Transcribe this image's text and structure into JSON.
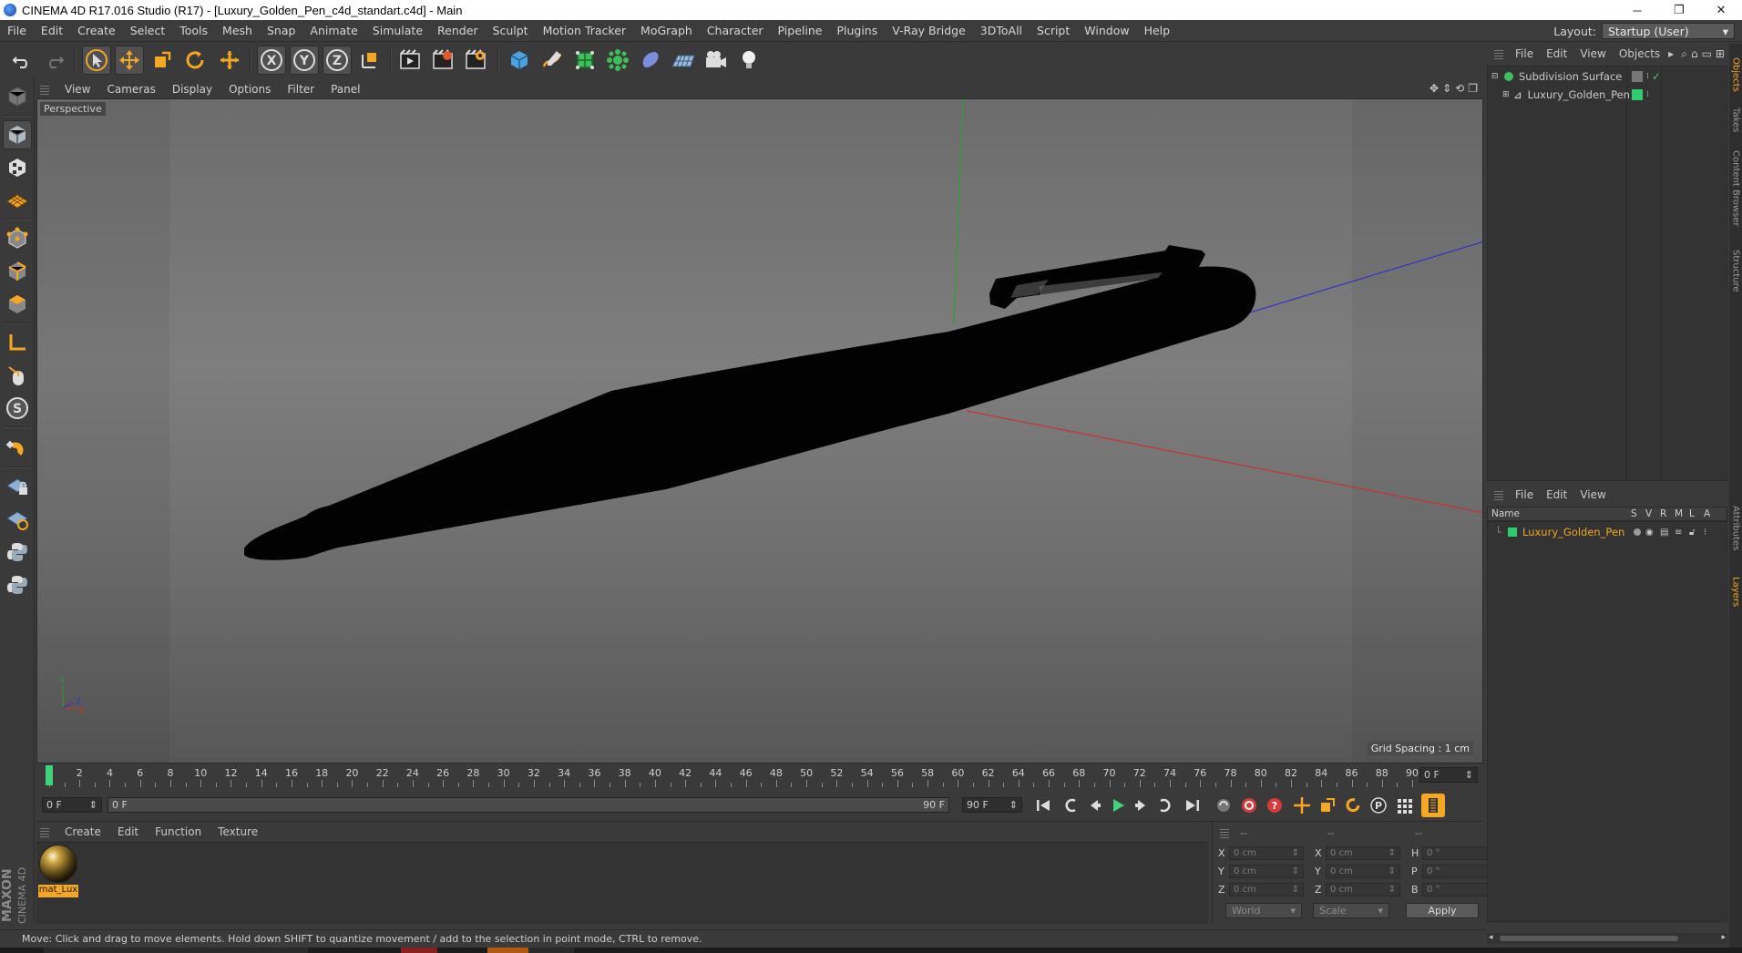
{
  "window": {
    "title": "CINEMA 4D R17.016 Studio (R17) - [Luxury_Golden_Pen_c4d_standart.c4d] - Main",
    "controls": [
      "─",
      "❐",
      "✕"
    ]
  },
  "menubar": {
    "items": [
      "File",
      "Edit",
      "Create",
      "Select",
      "Tools",
      "Mesh",
      "Snap",
      "Animate",
      "Simulate",
      "Render",
      "Sculpt",
      "Motion Tracker",
      "MoGraph",
      "Character",
      "Pipeline",
      "Plugins",
      "V-Ray Bridge",
      "3DToAll",
      "Script",
      "Window",
      "Help"
    ],
    "layout_label": "Layout:",
    "layout_value": "Startup (User)"
  },
  "viewport": {
    "menu": [
      "View",
      "Cameras",
      "Display",
      "Options",
      "Filter",
      "Panel"
    ],
    "camera_label": "Perspective",
    "grid_spacing": "Grid Spacing : 1 cm",
    "axis_labels": {
      "y": "Y",
      "z": "Z",
      "x": "X"
    }
  },
  "timeline": {
    "ticks": [
      "0",
      "2",
      "4",
      "6",
      "8",
      "10",
      "12",
      "14",
      "16",
      "18",
      "20",
      "22",
      "24",
      "26",
      "28",
      "30",
      "32",
      "34",
      "36",
      "38",
      "40",
      "42",
      "44",
      "46",
      "48",
      "50",
      "52",
      "54",
      "56",
      "58",
      "60",
      "62",
      "64",
      "66",
      "68",
      "70",
      "72",
      "74",
      "76",
      "78",
      "80",
      "82",
      "84",
      "86",
      "88",
      "90"
    ],
    "current_frame": "0 F",
    "start_field": "0 F",
    "range_start": "0 F",
    "range_end": "90 F",
    "end_field": "90 F"
  },
  "materials": {
    "menu": [
      "Create",
      "Edit",
      "Function",
      "Texture"
    ],
    "items": [
      {
        "name": "mat_Lux"
      }
    ]
  },
  "coordinates": {
    "headers": [
      "--",
      "--",
      "--"
    ],
    "rows": [
      {
        "a": "X",
        "av": "0 cm",
        "b": "X",
        "bv": "0 cm",
        "c": "H",
        "cv": "0 °"
      },
      {
        "a": "Y",
        "av": "0 cm",
        "b": "Y",
        "bv": "0 cm",
        "c": "P",
        "cv": "0 °"
      },
      {
        "a": "Z",
        "av": "0 cm",
        "b": "Z",
        "bv": "0 cm",
        "c": "B",
        "cv": "0 °"
      }
    ],
    "space": "World",
    "mode": "Scale",
    "apply": "Apply"
  },
  "objects": {
    "menu": [
      "File",
      "Edit",
      "View",
      "Objects"
    ],
    "items": [
      {
        "name": "Subdivision Surface",
        "level": 0
      },
      {
        "name": "Luxury_Golden_Pen",
        "level": 1
      }
    ]
  },
  "layers": {
    "menu": [
      "File",
      "Edit",
      "View"
    ],
    "columns": [
      "Name",
      "S",
      "V",
      "R",
      "M",
      "L",
      "A"
    ],
    "items": [
      {
        "name": "Luxury_Golden_Pen",
        "color": "#2ecc71"
      }
    ]
  },
  "side_tabs": [
    "Objects",
    "Takes",
    "Content Browser",
    "Structure",
    "Attributes",
    "Layers"
  ],
  "status": "Move: Click and drag to move elements. Hold down SHIFT to quantize movement / add to the selection in point mode, CTRL to remove.",
  "colors": {
    "accent": "#f5a623",
    "playhead": "#3fd27a",
    "layer_green": "#2ecc71",
    "axis_x": "#c83232",
    "axis_y": "#2fa02f",
    "axis_z": "#3232c8"
  },
  "icons": {
    "toolbar": [
      "undo-icon",
      "redo-icon",
      "select-arrow-icon",
      "move-icon",
      "scale-icon",
      "rotate-icon",
      "live-select-icon",
      "x-axis-icon",
      "y-axis-icon",
      "z-axis-icon",
      "world-coord-icon",
      "render-view-icon",
      "render-picture-viewer-icon",
      "render-settings-icon",
      "cube-icon",
      "pen-spline-icon",
      "subdivision-icon",
      "cloner-icon",
      "deformer-icon",
      "floor-icon",
      "camera-icon",
      "light-icon"
    ]
  }
}
